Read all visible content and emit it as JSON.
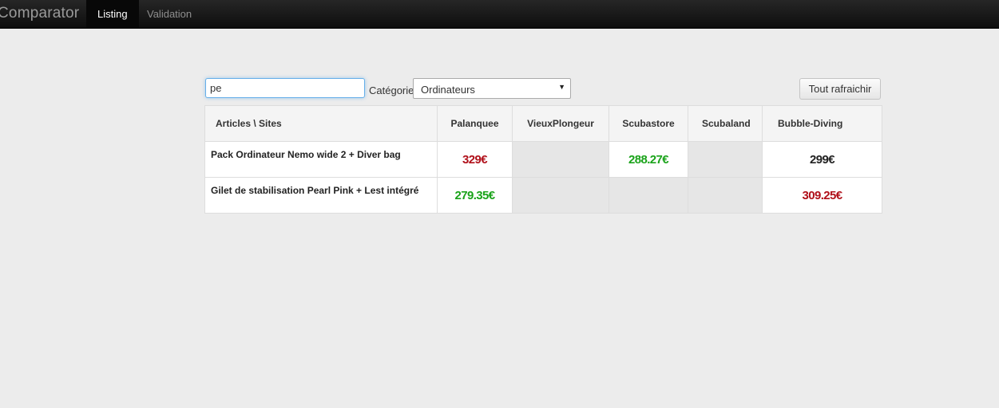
{
  "navbar": {
    "brand": "Comparator",
    "tabs": [
      {
        "label": "Listing",
        "active": true
      },
      {
        "label": "Validation",
        "active": false
      }
    ]
  },
  "filters": {
    "search_value": "pe",
    "category_label": "Catégorie",
    "category_selected": "Ordinateurs",
    "refresh_label": "Tout rafraichir"
  },
  "table": {
    "corner_header": "Articles \\ Sites",
    "sites": [
      "Palanquee",
      "VieuxPlongeur",
      "Scubastore",
      "Scubaland",
      "Bubble-Diving"
    ],
    "rows": [
      {
        "article": "Pack Ordinateur Nemo wide 2 + Diver bag",
        "prices": [
          {
            "text": "329€",
            "status": "high"
          },
          null,
          {
            "text": "288.27€",
            "status": "best"
          },
          null,
          {
            "text": "299€",
            "status": "neutral"
          }
        ]
      },
      {
        "article": "Gilet de stabilisation Pearl Pink + Lest intégré",
        "prices": [
          {
            "text": "279.35€",
            "status": "best"
          },
          null,
          null,
          null,
          {
            "text": "309.25€",
            "status": "high"
          }
        ]
      }
    ]
  },
  "colors": {
    "best": "#1aa31a",
    "high": "#b0101a",
    "neutral": "#222222"
  }
}
